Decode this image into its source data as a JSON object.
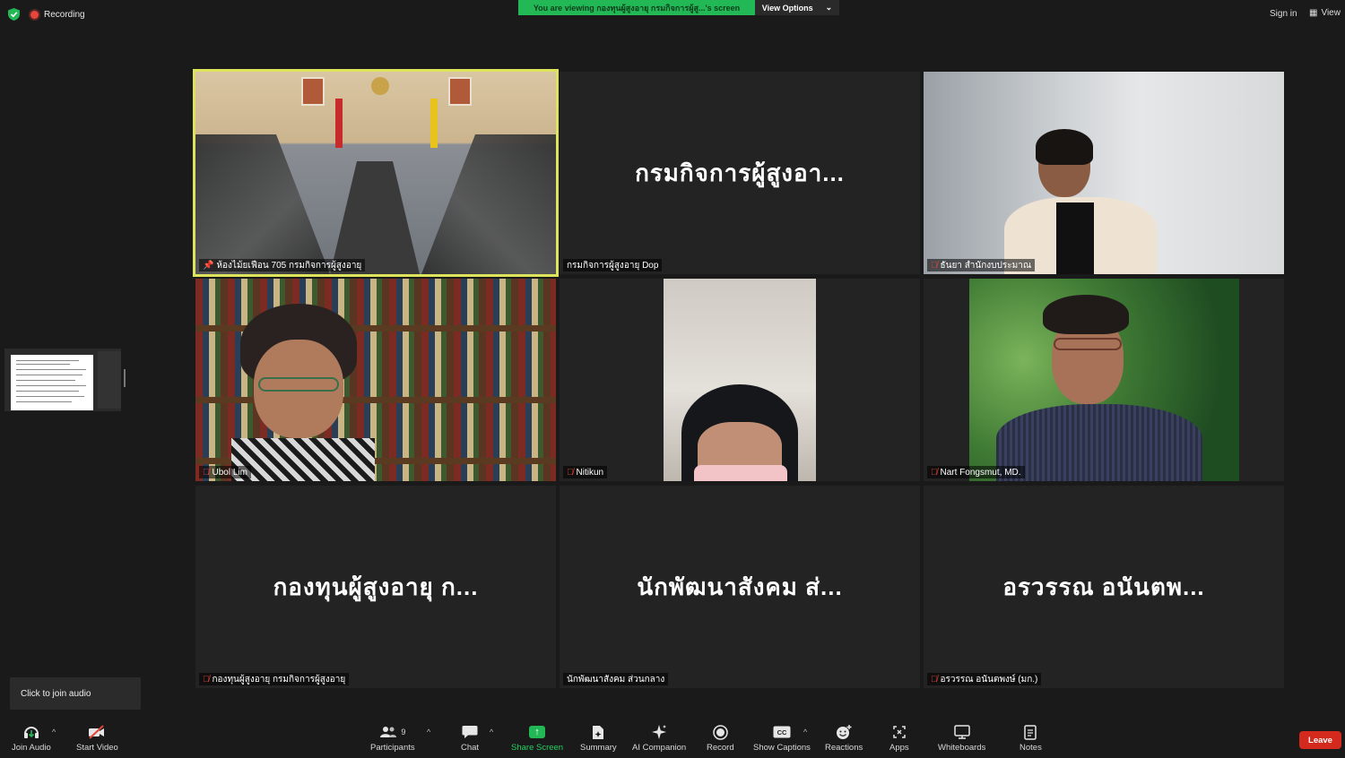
{
  "top_bar": {
    "recording_label": "Recording",
    "viewing_banner": "You are viewing กองทุนผู้สูงอายุ กรมกิจการผู้สู...'s screen",
    "view_options_label": "View Options",
    "sign_in_label": "Sign in",
    "view_label": "View"
  },
  "tiles": [
    {
      "display_name": "",
      "label": "ห้องไม้ยเฟือน 705 กรมกิจการผู้สูงอายุ",
      "active": true,
      "muted": false,
      "pinned": true,
      "kind": "meeting-room"
    },
    {
      "display_name": "กรมกิจการผู้สูงอา...",
      "label": "กรมกิจการผู้สูงอายุ Dop",
      "muted": false,
      "kind": "name-only"
    },
    {
      "display_name": "",
      "label": "ธันยา สำนักงบประมาณ",
      "muted": true,
      "kind": "video"
    },
    {
      "display_name": "",
      "label": "Ubol Lim",
      "muted": true,
      "kind": "video"
    },
    {
      "display_name": "",
      "label": "Nitikun",
      "muted": true,
      "kind": "video"
    },
    {
      "display_name": "",
      "label": "Nart Fongsmut, MD.",
      "muted": true,
      "kind": "video"
    },
    {
      "display_name": "กองทุนผู้สูงอายุ ก...",
      "label": "กองทุนผู้สูงอายุ กรมกิจการผู้สูงอายุ",
      "muted": true,
      "kind": "name-only"
    },
    {
      "display_name": "นักพัฒนาสังคม ส่...",
      "label": "นักพัฒนาสังคม ส่วนกลาง",
      "muted": false,
      "kind": "name-only"
    },
    {
      "display_name": "อรวรรณ อนันตพ...",
      "label": "อรวรรณ อนันตพงษ์ (มก.)",
      "muted": true,
      "kind": "name-only"
    }
  ],
  "tooltip": {
    "text": "Click to join audio"
  },
  "toolbar": {
    "join_audio": "Join Audio",
    "start_video": "Start Video",
    "participants": "Participants",
    "participants_count": "9",
    "chat": "Chat",
    "share_screen": "Share Screen",
    "summary": "Summary",
    "ai_companion": "AI Companion",
    "record": "Record",
    "show_captions": "Show Captions",
    "reactions": "Reactions",
    "apps": "Apps",
    "whiteboards": "Whiteboards",
    "notes": "Notes",
    "leave": "Leave"
  },
  "colors": {
    "background": "#1a1a1a",
    "tile": "#232323",
    "active_speaker_outline": "#dde35a",
    "share_green": "#23b856",
    "leave_red": "#d42a1d",
    "muted_red": "#e34234"
  },
  "icons": {
    "security": "shield-icon",
    "recording": "record-dot-icon",
    "audio": "headphones-icon",
    "video": "video-off-icon",
    "participants": "people-icon",
    "chat": "chat-bubble-icon",
    "share": "share-arrow-icon",
    "summary": "document-sparkle-icon",
    "ai": "sparkle-icon",
    "record": "record-icon",
    "captions": "cc-icon",
    "reactions": "smile-plus-icon",
    "apps": "apps-icon",
    "whiteboards": "whiteboard-icon",
    "notes": "notes-icon"
  }
}
